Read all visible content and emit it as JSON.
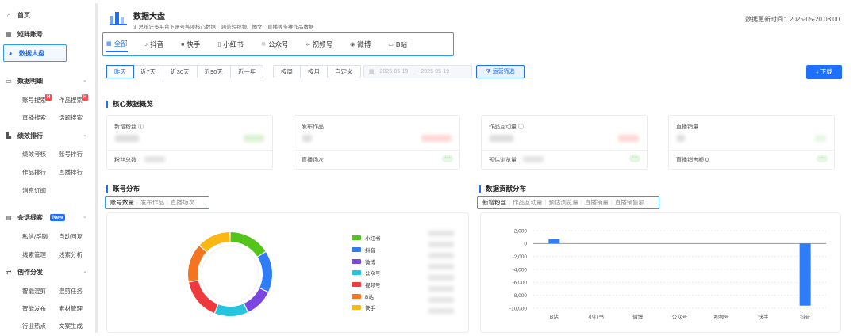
{
  "sidebar": {
    "home": "首页",
    "matrix": "矩阵账号",
    "dashboard": "数据大盘",
    "data_detail": {
      "title": "数据明细",
      "items": [
        "账号搜索",
        "作品搜索",
        "直播搜索",
        "话题搜索"
      ],
      "hot_badge": "H"
    },
    "performance": {
      "title": "绩效排行",
      "items": [
        "绩效考核",
        "账号排行",
        "作品排行",
        "直播排行"
      ]
    },
    "message": "消息订阅",
    "leads": {
      "title": "会话线索",
      "badge": "New",
      "items": [
        "私信/群聊",
        "自动回复",
        "线索管理",
        "线索分析"
      ]
    },
    "creation": {
      "title": "创作分发",
      "items": [
        "智能混剪",
        "混剪任务",
        "智能发布",
        "素材管理",
        "行业热点",
        "文案生成"
      ]
    }
  },
  "header": {
    "title": "数据大盘",
    "subtitle": "汇总统计多平台下账号各项核心数据，涵盖短视频、图文、直播等多维作品数据",
    "updated": "数据更新时间：2025-05-20 08:00",
    "tabs": [
      "全部",
      "抖音",
      "快手",
      "小红书",
      "公众号",
      "视频号",
      "微博",
      "B站"
    ],
    "active_tab": "全部"
  },
  "filters": {
    "range": [
      "昨天",
      "近7天",
      "近30天",
      "近90天",
      "近一年"
    ],
    "period": [
      "按周",
      "按月",
      "自定义"
    ],
    "date_start": "2025-05-19",
    "date_sep": "~",
    "date_end": "2025-05-19",
    "op_filter": "运营筛选",
    "download": "下载"
  },
  "core": {
    "title": "核心数据概览",
    "cards": [
      {
        "label": "新增粉丝 ⓘ",
        "label2": "粉丝总数",
        "value2": ""
      },
      {
        "label": "发布作品",
        "label2": "直播场次",
        "value2": ""
      },
      {
        "label": "作品互动量 ⓘ",
        "label2": "预估浏览量",
        "value2": ""
      },
      {
        "label": "直播销量",
        "label2": "直播销售额",
        "value2": "0"
      }
    ],
    "more": "···"
  },
  "account_dist": {
    "title": "账号分布",
    "tabs": [
      "账号数量",
      "发布作品",
      "直播场次"
    ],
    "legend": [
      {
        "name": "小红书",
        "color": "#52c41a"
      },
      {
        "name": "抖音",
        "color": "#2f7df6"
      },
      {
        "name": "微博",
        "color": "#7b47e0"
      },
      {
        "name": "公众号",
        "color": "#27c4de"
      },
      {
        "name": "视频号",
        "color": "#f0393c"
      },
      {
        "name": "B站",
        "color": "#f4741f"
      },
      {
        "name": "快手",
        "color": "#fbb812"
      }
    ]
  },
  "contrib_dist": {
    "title": "数据贡献分布",
    "tabs": [
      "新增粉丝",
      "作品互动量",
      "预估浏览量",
      "直播销量",
      "直播销售额"
    ]
  },
  "chart_data": [
    {
      "type": "pie",
      "title": "账号分布",
      "labels": [
        "小红书",
        "抖音",
        "微博",
        "公众号",
        "视频号",
        "B站",
        "快手"
      ],
      "values": [
        16,
        16,
        11,
        13,
        16,
        15,
        13
      ],
      "colors": [
        "#52c41a",
        "#2f7df6",
        "#7b47e0",
        "#27c4de",
        "#f0393c",
        "#f4741f",
        "#fbb812"
      ]
    },
    {
      "type": "bar",
      "title": "数据贡献分布",
      "categories": [
        "B站",
        "小红书",
        "微博",
        "公众号",
        "视频号",
        "快手",
        "抖音"
      ],
      "values": [
        700,
        0,
        0,
        0,
        0,
        0,
        -9600
      ],
      "ylim": [
        -10000,
        2000
      ],
      "yticks": [
        "2,000",
        "0",
        "-2,000",
        "-4,000",
        "-6,000",
        "-8,000",
        "-10,000"
      ],
      "grid": true,
      "color": "#2f7df6"
    }
  ]
}
